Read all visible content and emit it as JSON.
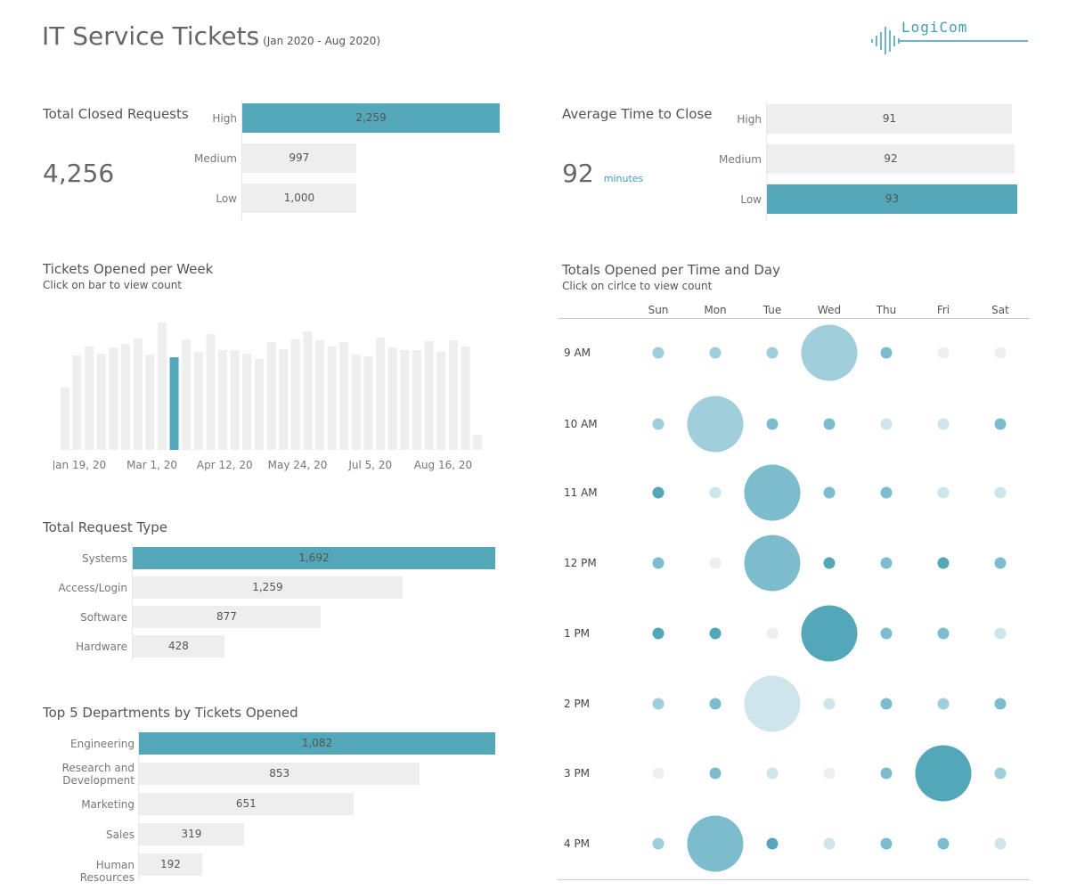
{
  "header": {
    "title": "IT Service Tickets",
    "date_range": "(Jan 2020 - Aug 2020)",
    "logo_text": "LogiCom",
    "logo_icon": "waveform-icon"
  },
  "colors": {
    "highlight": "#54a6b9",
    "bar": "#eeeeee",
    "accent": "#3e9db3"
  },
  "closed_requests": {
    "title": "Total Closed Requests",
    "total": "4,256",
    "chart_data": {
      "type": "bar",
      "categories": [
        "High",
        "Medium",
        "Low"
      ],
      "values": [
        2259,
        997,
        1000
      ],
      "labels": [
        "2,259",
        "997",
        "1,000"
      ],
      "highlight": "High"
    }
  },
  "avg_time": {
    "title": "Average Time to Close",
    "value": "92",
    "unit": "minutes",
    "chart_data": {
      "type": "bar",
      "categories": [
        "High",
        "Medium",
        "Low"
      ],
      "values": [
        91,
        92,
        93
      ],
      "labels": [
        "91",
        "92",
        "93"
      ],
      "highlight": "Low"
    }
  },
  "weekly": {
    "title": "Tickets Opened per Week",
    "subtitle": "Click on bar to view count",
    "chart_data": {
      "type": "bar",
      "values": [
        70,
        106,
        116,
        108,
        115,
        119,
        125,
        107,
        143,
        104,
        124,
        110,
        130,
        112,
        112,
        108,
        102,
        121,
        113,
        124,
        133,
        123,
        116,
        121,
        107,
        105,
        126,
        115,
        112,
        112,
        122,
        110,
        123,
        116,
        17
      ],
      "highlight_index": 9,
      "tick_labels": [
        "Jan 19, 20",
        "Mar 1, 20",
        "Apr 12, 20",
        "May 24, 20",
        "Jul 5, 20",
        "Aug 16, 20"
      ],
      "tick_indices": [
        3,
        9,
        15,
        21,
        27,
        33
      ]
    }
  },
  "request_type": {
    "title": "Total Request Type",
    "chart_data": {
      "type": "bar",
      "categories": [
        "Systems",
        "Access/Login",
        "Software",
        "Hardware"
      ],
      "values": [
        1692,
        1259,
        877,
        428
      ],
      "labels": [
        "1,692",
        "1,259",
        "877",
        "428"
      ],
      "highlight": "Systems"
    }
  },
  "departments": {
    "title": "Top 5 Departments by Tickets Opened",
    "chart_data": {
      "type": "bar",
      "categories": [
        "Engineering",
        "Research and Development",
        "Marketing",
        "Sales",
        "Human Resources"
      ],
      "values": [
        1082,
        853,
        651,
        319,
        192
      ],
      "labels": [
        "1,082",
        "853",
        "651",
        "319",
        "192"
      ],
      "highlight": "Engineering"
    }
  },
  "time_day": {
    "title": "Totals Opened per Time and Day",
    "subtitle": "Click on cirlce to view count",
    "chart_data": {
      "type": "scatter",
      "days": [
        "Sun",
        "Mon",
        "Tue",
        "Wed",
        "Thu",
        "Fri",
        "Sat"
      ],
      "times": [
        "9 AM",
        "10 AM",
        "11 AM",
        "12 PM",
        "1 PM",
        "2 PM",
        "3 PM",
        "4 PM"
      ],
      "size_levels": [
        [
          1,
          1,
          1,
          3,
          1,
          1,
          1
        ],
        [
          1,
          3,
          1,
          1,
          1,
          1,
          1
        ],
        [
          1,
          1,
          3,
          1,
          1,
          1,
          1
        ],
        [
          1,
          1,
          3,
          1,
          1,
          1,
          1
        ],
        [
          1,
          1,
          1,
          3,
          1,
          1,
          1
        ],
        [
          1,
          1,
          3,
          1,
          1,
          1,
          1
        ],
        [
          1,
          1,
          1,
          1,
          1,
          3,
          1
        ],
        [
          1,
          3,
          1,
          1,
          1,
          1,
          1
        ]
      ],
      "color_levels": [
        [
          2,
          2,
          2,
          2,
          3,
          0,
          0
        ],
        [
          2,
          2,
          3,
          3,
          1,
          1,
          3
        ],
        [
          4,
          1,
          3,
          3,
          3,
          1,
          1
        ],
        [
          3,
          0,
          3,
          4,
          3,
          4,
          3
        ],
        [
          4,
          4,
          0,
          4,
          3,
          3,
          1
        ],
        [
          2,
          3,
          1,
          1,
          3,
          2,
          3
        ],
        [
          0,
          3,
          1,
          0,
          3,
          4,
          2
        ],
        [
          2,
          3,
          4,
          1,
          3,
          3,
          1
        ]
      ]
    }
  }
}
